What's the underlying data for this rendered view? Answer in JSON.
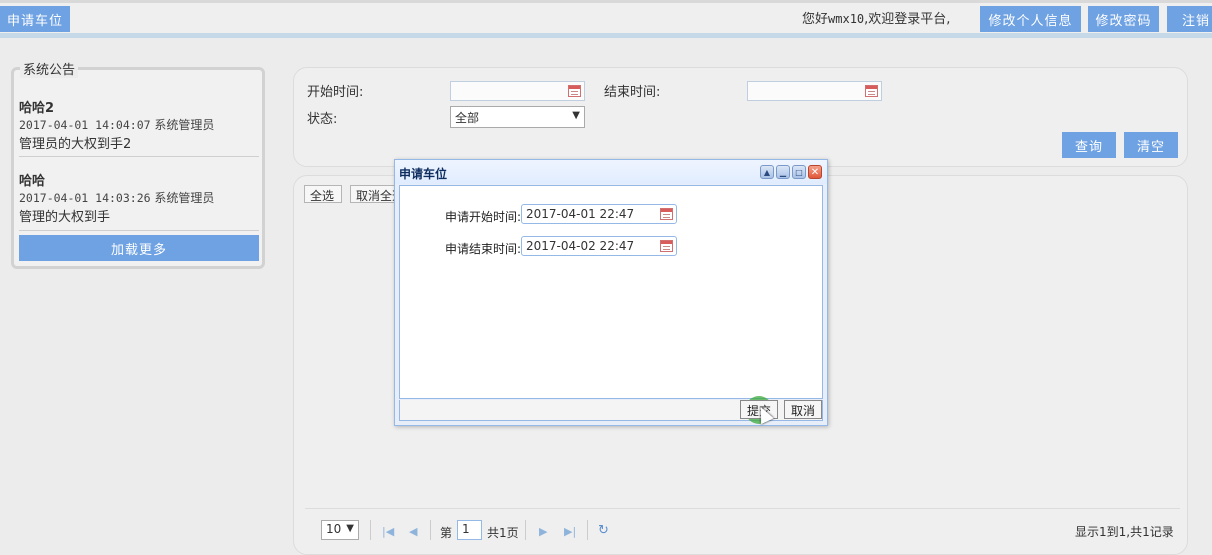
{
  "topbar": {
    "apply_button": "申请车位",
    "welcome_prefix": "您好",
    "username": "wmx10",
    "welcome_suffix": ",欢迎登录平台,",
    "edit_profile": "修改个人信息",
    "change_password": "修改密码",
    "logout": "注销"
  },
  "notice": {
    "legend": "系统公告",
    "items": [
      {
        "title": "哈哈2",
        "datetime": "2017-04-01 14:04:07",
        "author": "系统管理员",
        "body": "管理员的大权到手2"
      },
      {
        "title": "哈哈",
        "datetime": "2017-04-01 14:03:26",
        "author": "系统管理员",
        "body": "管理的大权到手"
      }
    ],
    "load_more": "加载更多"
  },
  "query": {
    "start_label": "开始时间:",
    "end_label": "结束时间:",
    "status_label": "状态:",
    "status_value": "全部",
    "search_button": "查询",
    "clear_button": "清空"
  },
  "grid": {
    "select_all": "全选",
    "deselect_all": "取消全选",
    "pager": {
      "page_size": "10",
      "page_prefix": "第",
      "page_number": "1",
      "page_total": "共1页",
      "summary": "显示1到1,共1记录"
    }
  },
  "dialog": {
    "title": "申请车位",
    "start_label": "申请开始时间:",
    "start_value": "2017-04-01 22:47",
    "end_label": "申请结束时间:",
    "end_value": "2017-04-02 22:47",
    "submit": "提交",
    "cancel": "取消"
  }
}
